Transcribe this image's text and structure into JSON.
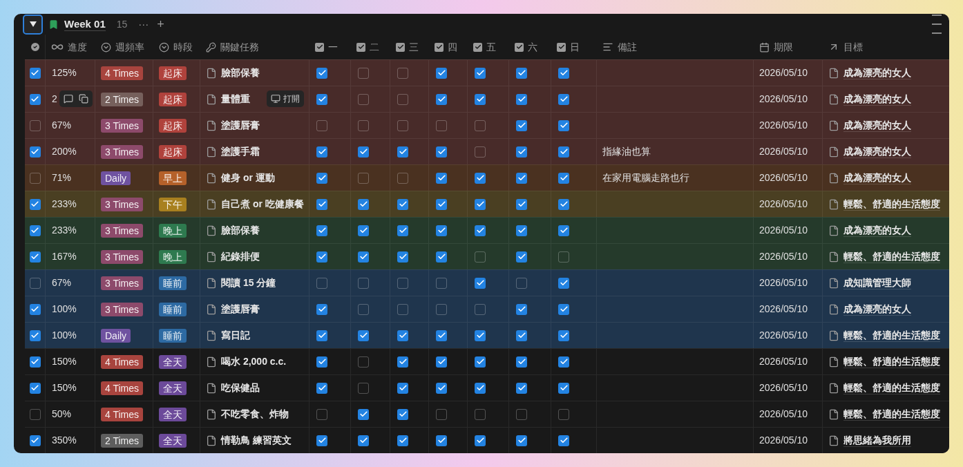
{
  "view": {
    "title": "Week 01",
    "count": "15",
    "more": "···",
    "add": "+"
  },
  "columns": [
    {
      "kind": "done"
    },
    {
      "kind": "progress",
      "label": "進度"
    },
    {
      "kind": "select",
      "label": "週頻率"
    },
    {
      "kind": "select",
      "label": "時段"
    },
    {
      "kind": "title",
      "label": "關鍵任務"
    },
    {
      "kind": "checkbox",
      "label": "一"
    },
    {
      "kind": "checkbox",
      "label": "二"
    },
    {
      "kind": "checkbox",
      "label": "三"
    },
    {
      "kind": "checkbox",
      "label": "四"
    },
    {
      "kind": "checkbox",
      "label": "五"
    },
    {
      "kind": "checkbox",
      "label": "六"
    },
    {
      "kind": "checkbox",
      "label": "日"
    },
    {
      "kind": "text",
      "label": "備註"
    },
    {
      "kind": "date",
      "label": "期限"
    },
    {
      "kind": "relation",
      "label": "目標"
    }
  ],
  "rows": [
    {
      "color": "#482b29",
      "done": true,
      "progress": "125%",
      "frequency": {
        "label": "4 Times",
        "color": "#a8443e"
      },
      "period": {
        "label": "起床",
        "color": "#b0423c"
      },
      "task": "臉部保養",
      "days": [
        true,
        false,
        false,
        true,
        true,
        true,
        true
      ],
      "deadline": "2026/05/10",
      "goal": "成為漂亮的女人"
    },
    {
      "color": "#482b29",
      "done": true,
      "progress": "2",
      "frequency": {
        "label": "2 Times",
        "color": "#76605c"
      },
      "period": {
        "label": "起床",
        "color": "#b0423c"
      },
      "task": "量體重",
      "hover": {
        "open_label": "打開"
      },
      "days": [
        true,
        false,
        false,
        true,
        true,
        true,
        true
      ],
      "deadline": "2026/05/10",
      "goal": "成為漂亮的女人"
    },
    {
      "color": "#482b29",
      "done": false,
      "progress": "67%",
      "frequency": {
        "label": "3 Times",
        "color": "#8d4a6b"
      },
      "period": {
        "label": "起床",
        "color": "#b0423c"
      },
      "task": "塗護唇膏",
      "days": [
        false,
        false,
        false,
        false,
        false,
        true,
        true
      ],
      "deadline": "2026/05/10",
      "goal": "成為漂亮的女人"
    },
    {
      "color": "#482b29",
      "done": true,
      "progress": "200%",
      "frequency": {
        "label": "3 Times",
        "color": "#8d4a6b"
      },
      "period": {
        "label": "起床",
        "color": "#b0423c"
      },
      "task": "塗護手霜",
      "days": [
        true,
        true,
        true,
        true,
        false,
        true,
        true
      ],
      "note": "指緣油也算",
      "deadline": "2026/05/10",
      "goal": "成為漂亮的女人"
    },
    {
      "color": "#4a3120",
      "done": false,
      "progress": "71%",
      "frequency": {
        "label": "Daily",
        "color": "#6f52a0"
      },
      "period": {
        "label": "早上",
        "color": "#b5612a"
      },
      "task": "健身 or 運動",
      "days": [
        true,
        false,
        false,
        true,
        true,
        true,
        true
      ],
      "note": "在家用電腦走路也行",
      "deadline": "2026/05/10",
      "goal": "成為漂亮的女人"
    },
    {
      "color": "#4a3f22",
      "done": true,
      "progress": "233%",
      "frequency": {
        "label": "3 Times",
        "color": "#8d4a6b"
      },
      "period": {
        "label": "下午",
        "color": "#a8801f"
      },
      "task": "自己煮 or 吃健康餐",
      "days": [
        true,
        true,
        true,
        true,
        true,
        true,
        true
      ],
      "deadline": "2026/05/10",
      "goal": "輕鬆、舒適的生活態度"
    },
    {
      "color": "#253a2b",
      "done": true,
      "progress": "233%",
      "frequency": {
        "label": "3 Times",
        "color": "#8d4a6b"
      },
      "period": {
        "label": "晚上",
        "color": "#2e7a4f"
      },
      "task": "臉部保養",
      "days": [
        true,
        true,
        true,
        true,
        true,
        true,
        true
      ],
      "deadline": "2026/05/10",
      "goal": "成為漂亮的女人"
    },
    {
      "color": "#253a2b",
      "done": true,
      "progress": "167%",
      "frequency": {
        "label": "3 Times",
        "color": "#8d4a6b"
      },
      "period": {
        "label": "晚上",
        "color": "#2e7a4f"
      },
      "task": "紀錄排便",
      "days": [
        true,
        true,
        true,
        true,
        false,
        true,
        false
      ],
      "deadline": "2026/05/10",
      "goal": "輕鬆、舒適的生活態度"
    },
    {
      "color": "#1f354d",
      "done": false,
      "progress": "67%",
      "frequency": {
        "label": "3 Times",
        "color": "#8d4a6b"
      },
      "period": {
        "label": "睡前",
        "color": "#2d6aa3"
      },
      "task": "閱讀 15 分鐘",
      "days": [
        false,
        false,
        false,
        false,
        true,
        false,
        true
      ],
      "deadline": "2026/05/10",
      "goal": "成知識管理大師"
    },
    {
      "color": "#1f354d",
      "done": true,
      "progress": "100%",
      "frequency": {
        "label": "3 Times",
        "color": "#8d4a6b"
      },
      "period": {
        "label": "睡前",
        "color": "#2d6aa3"
      },
      "task": "塗護唇膏",
      "days": [
        true,
        false,
        false,
        false,
        false,
        true,
        true
      ],
      "deadline": "2026/05/10",
      "goal": "成為漂亮的女人"
    },
    {
      "color": "#1f354d",
      "done": true,
      "progress": "100%",
      "frequency": {
        "label": "Daily",
        "color": "#6f52a0"
      },
      "period": {
        "label": "睡前",
        "color": "#2d6aa3"
      },
      "task": "寫日記",
      "days": [
        true,
        true,
        true,
        true,
        true,
        true,
        true
      ],
      "deadline": "2026/05/10",
      "goal": "輕鬆、舒適的生活態度"
    },
    {
      "color": "#191919",
      "done": true,
      "progress": "150%",
      "frequency": {
        "label": "4 Times",
        "color": "#a8443e"
      },
      "period": {
        "label": "全天",
        "color": "#6c4a9a"
      },
      "task": "喝水 2,000 c.c.",
      "days": [
        true,
        false,
        true,
        true,
        true,
        true,
        true
      ],
      "deadline": "2026/05/10",
      "goal": "輕鬆、舒適的生活態度"
    },
    {
      "color": "#191919",
      "done": true,
      "progress": "150%",
      "frequency": {
        "label": "4 Times",
        "color": "#a8443e"
      },
      "period": {
        "label": "全天",
        "color": "#6c4a9a"
      },
      "task": "吃保健品",
      "days": [
        true,
        false,
        true,
        true,
        true,
        true,
        true
      ],
      "deadline": "2026/05/10",
      "goal": "輕鬆、舒適的生活態度"
    },
    {
      "color": "#191919",
      "done": false,
      "progress": "50%",
      "frequency": {
        "label": "4 Times",
        "color": "#a8443e"
      },
      "period": {
        "label": "全天",
        "color": "#6c4a9a"
      },
      "task": "不吃零食、炸物",
      "days": [
        false,
        true,
        true,
        false,
        false,
        false,
        false
      ],
      "deadline": "2026/05/10",
      "goal": "輕鬆、舒適的生活態度"
    },
    {
      "color": "#191919",
      "done": true,
      "progress": "350%",
      "frequency": {
        "label": "2 Times",
        "color": "#5e5e5e"
      },
      "period": {
        "label": "全天",
        "color": "#6c4a9a"
      },
      "task": "情勒鳥 練習英文",
      "days": [
        true,
        true,
        true,
        true,
        true,
        true,
        true
      ],
      "deadline": "2026/05/10",
      "goal": "將思緒為我所用"
    }
  ]
}
